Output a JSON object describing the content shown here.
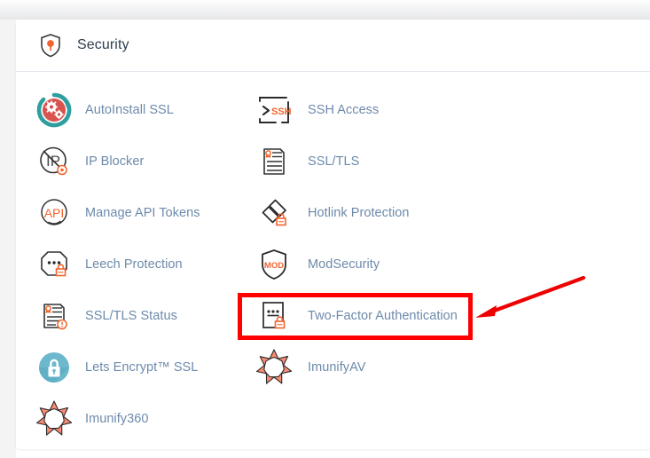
{
  "page": {
    "background_color": "#ffffff",
    "card_background": "#ffffff",
    "divider_color": "#e3e8ee"
  },
  "header": {
    "title": "Security",
    "icon": "shield-pin-icon",
    "title_color": "#2f3e4f"
  },
  "theme": {
    "link_color": "#6d8aab",
    "accent_orange": "#f0652f",
    "accent_teal": "#2e9e9e",
    "accent_red": "#d9534f",
    "accent_lightblue": "#6cb8cc",
    "imunify_salmon": "#fa8a72",
    "highlight_red": "#ff0000"
  },
  "left_column": [
    {
      "label": "AutoInstall SSL",
      "icon": "autoinstall-ssl-icon"
    },
    {
      "label": "IP Blocker",
      "icon": "ip-blocker-icon"
    },
    {
      "label": "Manage API Tokens",
      "icon": "api-tokens-icon"
    },
    {
      "label": "Leech Protection",
      "icon": "leech-protection-icon"
    },
    {
      "label": "SSL/TLS Status",
      "icon": "ssl-tls-status-icon"
    },
    {
      "label": "Lets Encrypt™ SSL",
      "icon": "lets-encrypt-icon"
    },
    {
      "label": "Imunify360",
      "icon": "imunify-starburst-icon"
    }
  ],
  "right_column": [
    {
      "label": "SSH Access",
      "icon": "ssh-terminal-icon"
    },
    {
      "label": "SSL/TLS",
      "icon": "ssl-tls-icon"
    },
    {
      "label": "Hotlink Protection",
      "icon": "hotlink-protection-icon"
    },
    {
      "label": "ModSecurity",
      "icon": "modsecurity-shield-icon"
    },
    {
      "label": "Two-Factor Authentication",
      "icon": "two-factor-auth-icon"
    },
    {
      "label": "ImunifyAV",
      "icon": "imunify-starburst-icon"
    }
  ],
  "annotations": {
    "highlight_target": "Two-Factor Authentication",
    "highlight_color": "#ff0000",
    "arrow_color": "#ff0000",
    "arrow_points_to": "Two-Factor Authentication"
  }
}
